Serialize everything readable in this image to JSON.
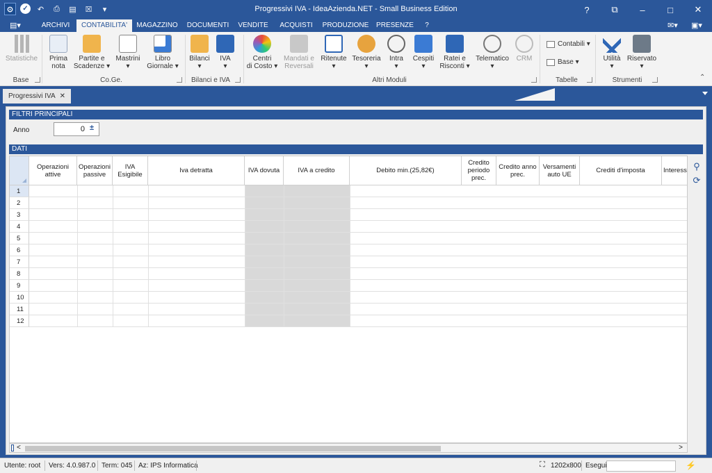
{
  "window": {
    "title": "Progressivi IVA - IdeaAzienda.NET - Small Business Edition",
    "controls": [
      "?",
      "⧉",
      "–",
      "□",
      "✕"
    ]
  },
  "menu": {
    "tabs": [
      "ARCHIVI",
      "CONTABILITA'",
      "MAGAZZINO",
      "DOCUMENTI",
      "VENDITE",
      "ACQUISTI",
      "PRODUZIONE",
      "PRESENZE",
      "?"
    ],
    "active": "CONTABILITA'"
  },
  "ribbon": {
    "buttons": [
      {
        "label": "Statistiche",
        "disabled": true
      },
      {
        "label": "Prima\nnota"
      },
      {
        "label": "Partite e\nScadenze ▾"
      },
      {
        "label": "Mastrini\n▾"
      },
      {
        "label": "Libro\nGiornale ▾"
      },
      {
        "label": "Bilanci\n▾"
      },
      {
        "label": "IVA\n▾"
      },
      {
        "label": "Centri\ndi Costo ▾"
      },
      {
        "label": "Mandati e\nReversali",
        "disabled": true
      },
      {
        "label": "Ritenute\n▾"
      },
      {
        "label": "Tesoreria\n▾"
      },
      {
        "label": "Intra\n▾"
      },
      {
        "label": "Cespiti\n▾"
      },
      {
        "label": "Ratei e\nRisconti ▾"
      },
      {
        "label": "Telematico\n▾"
      },
      {
        "label": "CRM",
        "disabled": true
      },
      {
        "label": "Utilità\n▾"
      },
      {
        "label": "Riservato\n▾"
      }
    ],
    "small_buttons": [
      "Contabili ▾",
      "Base ▾"
    ],
    "groups": [
      "Base",
      "Co.Ge.",
      "Bilanci e IVA",
      "Altri Moduli",
      "Tabelle",
      "Strumenti"
    ]
  },
  "doc_tab": {
    "label": "Progressivi IVA",
    "close": "✕"
  },
  "filters": {
    "title": "FILTRI PRINCIPALI",
    "anno_label": "Anno",
    "anno_value": "0",
    "spin": "±"
  },
  "data_section": {
    "title": "DATI",
    "columns": [
      "Operazioni attive",
      "Operazioni passive",
      "IVA Esigibile",
      "Iva detratta",
      "IVA dovuta",
      "IVA a credito",
      "Debito min.(25,82€)",
      "Credito periodo prec.",
      "Credito anno prec.",
      "Versamenti auto UE",
      "Crediti d'imposta",
      "Interessi"
    ],
    "rows": [
      "1",
      "2",
      "3",
      "4",
      "5",
      "6",
      "7",
      "8",
      "9",
      "10",
      "11",
      "12"
    ]
  },
  "side_icons": [
    "search-icon",
    "refresh-icon"
  ],
  "scroll": {
    "left": "<",
    "right": ">"
  },
  "status": {
    "utente": "Utente: root",
    "versione": "Vers: 4.0.987.0",
    "terminale": "Term: 045",
    "azienda": "Az: IPS Informatica",
    "risoluzione": "1202x800",
    "esegui": "Esegui"
  },
  "colors": {
    "accent": "#2b579a",
    "ribbon": "#f3f3f3",
    "grayband": "#d9d9d9"
  }
}
